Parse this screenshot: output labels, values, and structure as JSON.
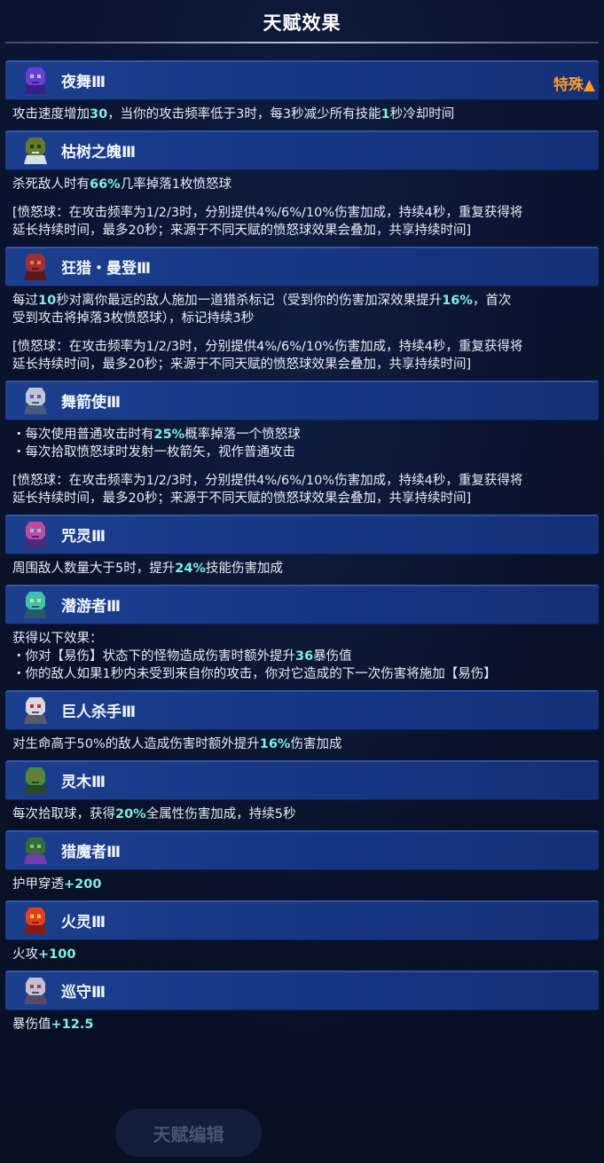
{
  "header": {
    "title": "天赋效果"
  },
  "footer": {
    "button_label": "天赋编辑"
  },
  "talents": [
    {
      "name": "夜舞Ⅲ",
      "icon": "night-dancer-icon",
      "tag": "特殊▲",
      "lines": [
        [
          "攻击速度增加",
          "30",
          "，当你的攻击频率低于3时，每3秒减少所有技能",
          "1",
          "秒冷却时间"
        ]
      ]
    },
    {
      "name": "枯树之魄Ⅲ",
      "icon": "withered-tree-icon",
      "lines": [
        [
          "杀死敌人时有",
          "66%",
          "几率掉落1枚愤怒球"
        ],
        [
          "GAP"
        ],
        [
          "[愤怒球：在攻击频率为1/2/3时，分别提供4%/6%/10%伤害加成，持续4秒，重复获得将"
        ],
        [
          "延长持续时间，最多20秒；来源于不同天赋的愤怒球效果会叠加，共享持续时间]"
        ]
      ]
    },
    {
      "name": "狂猎・曼登Ⅲ",
      "icon": "wild-hunt-icon",
      "lines": [
        [
          "每过",
          "10",
          "秒对离你最远的敌人施加一道猎杀标记（受到你的伤害加深效果提升",
          "16%",
          "，首次"
        ],
        [
          "受到攻击将掉落3枚愤怒球），标记持续3秒"
        ],
        [
          "GAP"
        ],
        [
          "[愤怒球：在攻击频率为1/2/3时，分别提供4%/6%/10%伤害加成，持续4秒，重复获得将"
        ],
        [
          "延长持续时间，最多20秒；来源于不同天赋的愤怒球效果会叠加，共享持续时间]"
        ]
      ]
    },
    {
      "name": "舞箭使Ⅲ",
      "icon": "arrow-dancer-icon",
      "lines": [
        [
          "・每次使用普通攻击时有",
          "25%",
          "概率掉落一个愤怒球"
        ],
        [
          "・每次拾取愤怒球时发射一枚箭矢，视作普通攻击"
        ],
        [
          "GAP"
        ],
        [
          "[愤怒球：在攻击频率为1/2/3时，分别提供4%/6%/10%伤害加成，持续4秒，重复获得将"
        ],
        [
          "延长持续时间，最多20秒；来源于不同天赋的愤怒球效果会叠加，共享持续时间]"
        ]
      ]
    },
    {
      "name": "咒灵Ⅲ",
      "icon": "curse-spirit-icon",
      "lines": [
        [
          "周围敌人数量大于5时，提升",
          "24%",
          "技能伤害加成"
        ]
      ]
    },
    {
      "name": "潜游者Ⅲ",
      "icon": "diver-icon",
      "lines": [
        [
          "获得以下效果："
        ],
        [
          "・你对【易伤】状态下的怪物造成伤害时额外提升",
          "36",
          "暴伤值"
        ],
        [
          "・你的敌人如果1秒内未受到来自你的攻击，你对它造成的下一次伤害将施加【易伤】"
        ]
      ]
    },
    {
      "name": "巨人杀手Ⅲ",
      "icon": "giant-slayer-icon",
      "lines": [
        [
          "对生命高于50%的敌人造成伤害时额外提升",
          "16%",
          "伤害加成"
        ]
      ]
    },
    {
      "name": "灵木Ⅲ",
      "icon": "spirit-wood-icon",
      "lines": [
        [
          "每次拾取球，获得",
          "20%",
          "全属性伤害加成，持续5秒"
        ]
      ]
    },
    {
      "name": "猎魔者Ⅲ",
      "icon": "demon-hunter-icon",
      "lines": [
        [
          "护甲穿透",
          "+200"
        ]
      ]
    },
    {
      "name": "火灵Ⅲ",
      "icon": "fire-spirit-icon",
      "lines": [
        [
          "火攻",
          "+100"
        ]
      ]
    },
    {
      "name": "巡守Ⅲ",
      "icon": "patrol-guard-icon",
      "lines": [
        [
          "暴伤值",
          "+12.5"
        ]
      ]
    }
  ],
  "icon_colors": {
    "night-dancer-icon": [
      "#6a3fd6",
      "#3a1f8a",
      "#9ed0ff"
    ],
    "withered-tree-icon": [
      "#5f7a2a",
      "#d8e0e8",
      "#2a3a18"
    ],
    "wild-hunt-icon": [
      "#a03030",
      "#5a1a1a",
      "#d08060"
    ],
    "arrow-dancer-icon": [
      "#b8c8d8",
      "#4a5a7a",
      "#7e4ab0"
    ],
    "curse-spirit-icon": [
      "#c04aa0",
      "#4a2a7a",
      "#6ad0e0"
    ],
    "diver-icon": [
      "#40c0b0",
      "#2a5a6a",
      "#e0e060"
    ],
    "giant-slayer-icon": [
      "#d8d8e0",
      "#5a5a6a",
      "#c03030"
    ],
    "spirit-wood-icon": [
      "#4a8a3a",
      "#2a4a20",
      "#e04040"
    ],
    "demon-hunter-icon": [
      "#3a6a3a",
      "#7a3ab0",
      "#50e050"
    ],
    "fire-spirit-icon": [
      "#e04020",
      "#8a1a10",
      "#ffd040"
    ],
    "patrol-guard-icon": [
      "#c0c0d0",
      "#5a4a6a",
      "#a04050"
    ]
  }
}
